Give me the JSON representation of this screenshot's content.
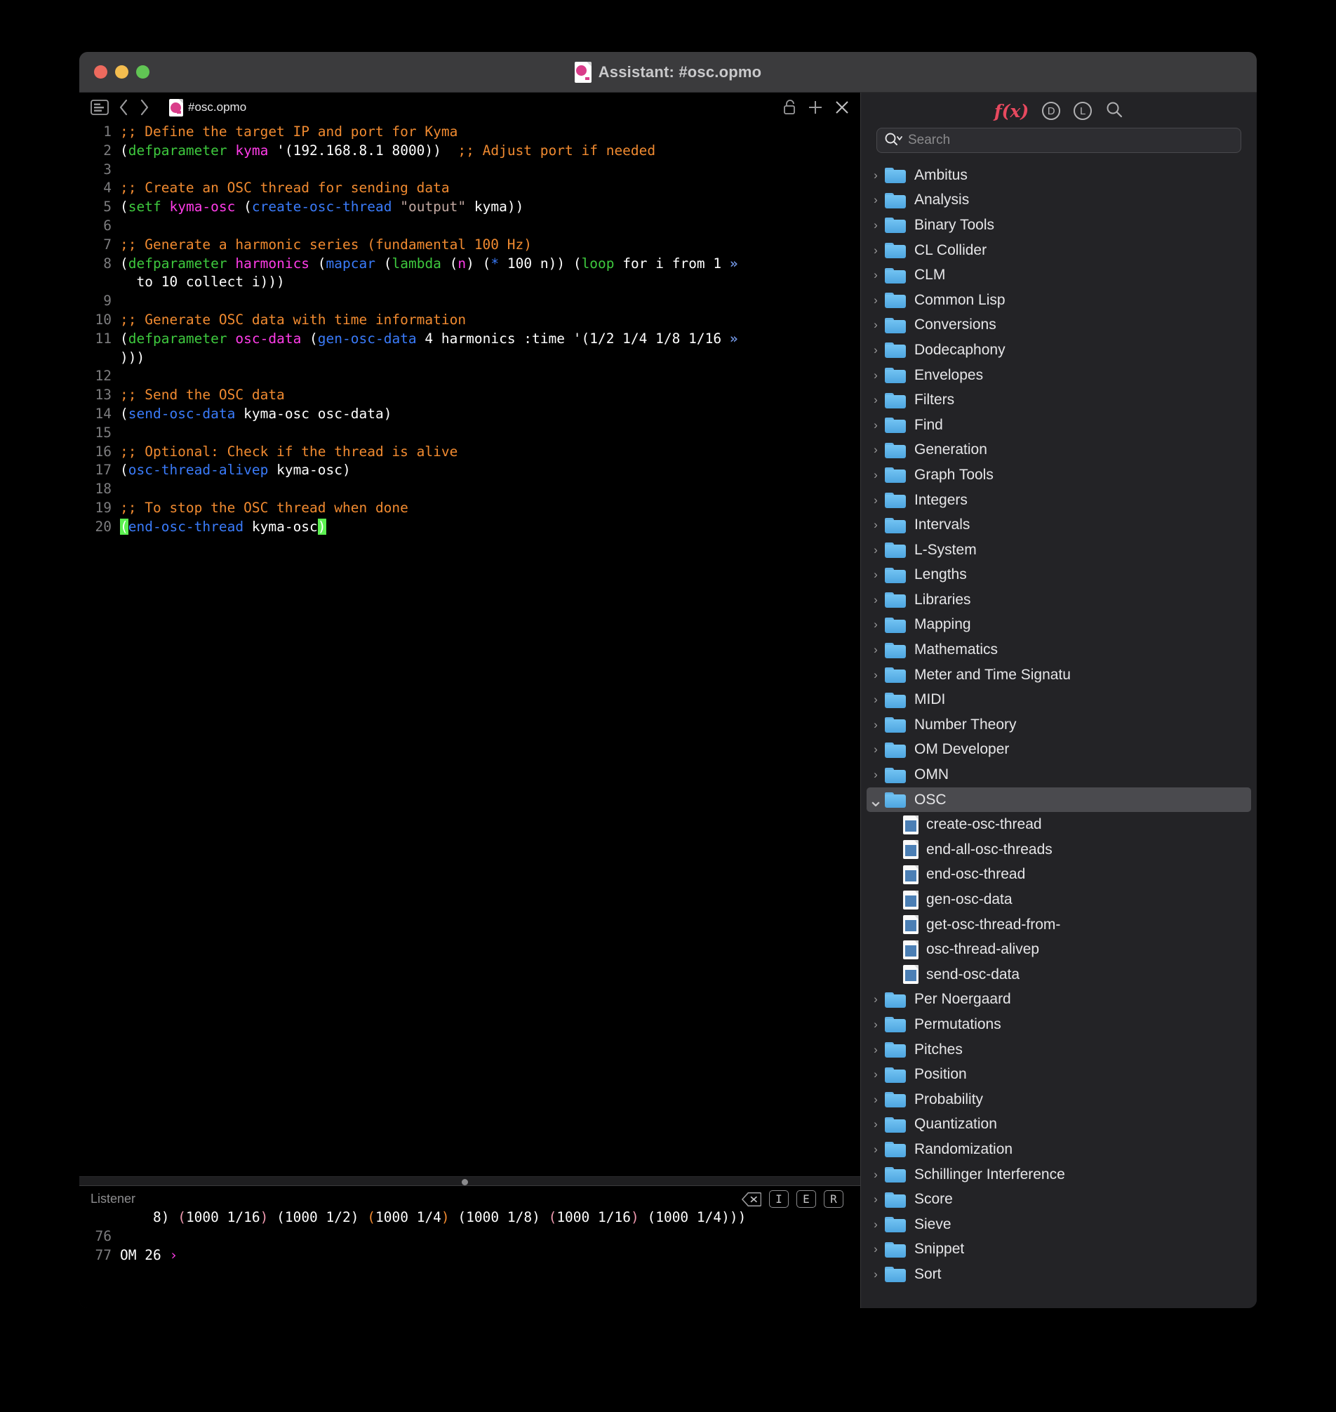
{
  "window": {
    "title": "Assistant: #osc.opmo",
    "traffic_lights": [
      "close",
      "minimize",
      "zoom"
    ]
  },
  "editor": {
    "tab_name": "#osc.opmo",
    "toolbar_icons": [
      "sidebar-icon",
      "back-icon",
      "forward-icon"
    ],
    "right_icons": [
      "unlock-icon",
      "add-icon",
      "close-icon"
    ],
    "lines": [
      {
        "n": "1",
        "tokens": [
          {
            "t": ";; Define the target IP and port for Kyma",
            "c": "c-comment"
          }
        ]
      },
      {
        "n": "2",
        "tokens": [
          {
            "t": "(",
            "c": "c-white"
          },
          {
            "t": "defparameter",
            "c": "c-green"
          },
          {
            "t": " ",
            "c": "c-white"
          },
          {
            "t": "kyma",
            "c": "c-magenta"
          },
          {
            "t": " '(192.168.8.1 8000))",
            "c": "c-white"
          },
          {
            "t": "  ;; Adjust port if needed",
            "c": "c-comment"
          }
        ]
      },
      {
        "n": "3",
        "tokens": []
      },
      {
        "n": "4",
        "tokens": [
          {
            "t": ";; Create an OSC thread for sending data",
            "c": "c-comment"
          }
        ]
      },
      {
        "n": "5",
        "tokens": [
          {
            "t": "(",
            "c": "c-white"
          },
          {
            "t": "setf",
            "c": "c-green"
          },
          {
            "t": " ",
            "c": "c-white"
          },
          {
            "t": "kyma-osc",
            "c": "c-magenta"
          },
          {
            "t": " (",
            "c": "c-white"
          },
          {
            "t": "create-osc-thread",
            "c": "c-blue"
          },
          {
            "t": " ",
            "c": "c-white"
          },
          {
            "t": "\"output\"",
            "c": "c-str"
          },
          {
            "t": " kyma))",
            "c": "c-white"
          }
        ]
      },
      {
        "n": "6",
        "tokens": []
      },
      {
        "n": "7",
        "tokens": [
          {
            "t": ";; Generate a harmonic series (fundamental 100 Hz)",
            "c": "c-comment"
          }
        ]
      },
      {
        "n": "8",
        "tokens": [
          {
            "t": "(",
            "c": "c-white"
          },
          {
            "t": "defparameter",
            "c": "c-green"
          },
          {
            "t": " ",
            "c": "c-white"
          },
          {
            "t": "harmonics",
            "c": "c-magenta"
          },
          {
            "t": " (",
            "c": "c-white"
          },
          {
            "t": "mapcar",
            "c": "c-blue"
          },
          {
            "t": " (",
            "c": "c-white"
          },
          {
            "t": "lambda",
            "c": "c-green"
          },
          {
            "t": " (",
            "c": "c-white"
          },
          {
            "t": "n",
            "c": "c-magenta"
          },
          {
            "t": ") (",
            "c": "c-white"
          },
          {
            "t": "*",
            "c": "c-blue"
          },
          {
            "t": " 100 n)) (",
            "c": "c-white"
          },
          {
            "t": "loop",
            "c": "c-green"
          },
          {
            "t": " for i from 1 ",
            "c": "c-white"
          },
          {
            "t": "»",
            "c": "wrapmark"
          }
        ],
        "wrap": "  to 10 collect i)))"
      },
      {
        "n": "9",
        "tokens": []
      },
      {
        "n": "10",
        "tokens": [
          {
            "t": ";; Generate OSC data with time information",
            "c": "c-comment"
          }
        ]
      },
      {
        "n": "11",
        "tokens": [
          {
            "t": "(",
            "c": "c-white"
          },
          {
            "t": "defparameter",
            "c": "c-green"
          },
          {
            "t": " ",
            "c": "c-white"
          },
          {
            "t": "osc-data",
            "c": "c-magenta"
          },
          {
            "t": " (",
            "c": "c-white"
          },
          {
            "t": "gen-osc-data",
            "c": "c-blue"
          },
          {
            "t": " 4 harmonics :time '(1/2 1/4 1/8 1/16 ",
            "c": "c-white"
          },
          {
            "t": "»",
            "c": "wrapmark"
          }
        ],
        "wrap": ")))"
      },
      {
        "n": "12",
        "tokens": []
      },
      {
        "n": "13",
        "tokens": [
          {
            "t": ";; Send the OSC data",
            "c": "c-comment"
          }
        ]
      },
      {
        "n": "14",
        "tokens": [
          {
            "t": "(",
            "c": "c-white"
          },
          {
            "t": "send-osc-data",
            "c": "c-blue"
          },
          {
            "t": " kyma-osc osc-data)",
            "c": "c-white"
          }
        ]
      },
      {
        "n": "15",
        "tokens": []
      },
      {
        "n": "16",
        "tokens": [
          {
            "t": ";; Optional: Check if the thread is alive",
            "c": "c-comment"
          }
        ]
      },
      {
        "n": "17",
        "tokens": [
          {
            "t": "(",
            "c": "c-white"
          },
          {
            "t": "osc-thread-alivep",
            "c": "c-blue"
          },
          {
            "t": " kyma-osc)",
            "c": "c-white"
          }
        ]
      },
      {
        "n": "18",
        "tokens": []
      },
      {
        "n": "19",
        "tokens": [
          {
            "t": ";; To stop the OSC thread when done",
            "c": "c-comment"
          }
        ]
      },
      {
        "n": "20",
        "tokens": [
          {
            "t": "(",
            "c": "sel"
          },
          {
            "t": "end-osc-thread",
            "c": "c-blue"
          },
          {
            "t": " kyma-osc",
            "c": "c-white"
          },
          {
            "t": ")",
            "c": "sel"
          }
        ]
      }
    ]
  },
  "listener": {
    "label": "Listener",
    "buttons": [
      "clear-icon",
      "I",
      "E",
      "R"
    ],
    "lines": [
      {
        "n": "",
        "tokens": [
          {
            "t": "    8) ",
            "c": "c-white"
          },
          {
            "t": "(",
            "c": "c-pink"
          },
          {
            "t": "1000 1/16",
            "c": "c-white"
          },
          {
            "t": ")",
            "c": "c-pink"
          },
          {
            "t": " (1000 1/2) ",
            "c": "c-white"
          },
          {
            "t": "(",
            "c": "c-comment"
          },
          {
            "t": "1000 1/4",
            "c": "c-white"
          },
          {
            "t": ")",
            "c": "c-comment"
          },
          {
            "t": " (1000 1/8) ",
            "c": "c-white"
          },
          {
            "t": "(",
            "c": "c-pink"
          },
          {
            "t": "1000 1/16",
            "c": "c-white"
          },
          {
            "t": ")",
            "c": "c-pink"
          },
          {
            "t": " (1000 1/4)))",
            "c": "c-white"
          }
        ]
      },
      {
        "n": "76",
        "tokens": []
      },
      {
        "n": "77",
        "tokens": [
          {
            "t": "OM 26 ",
            "c": "c-white"
          },
          {
            "t": "›",
            "c": "c-magenta"
          }
        ]
      }
    ]
  },
  "right_panel": {
    "header_icons": [
      "fx-icon",
      "documentation-icon",
      "library-icon",
      "search-icon"
    ],
    "fx_label": "f(x)",
    "d_label": "D",
    "l_label": "L",
    "search_placeholder": "Search",
    "search_value": "",
    "tree": [
      {
        "label": "Ambitus",
        "type": "folder",
        "state": "collapsed"
      },
      {
        "label": "Analysis",
        "type": "folder",
        "state": "collapsed"
      },
      {
        "label": "Binary Tools",
        "type": "folder",
        "state": "collapsed"
      },
      {
        "label": "CL Collider",
        "type": "folder",
        "state": "collapsed"
      },
      {
        "label": "CLM",
        "type": "folder",
        "state": "collapsed"
      },
      {
        "label": "Common Lisp",
        "type": "folder",
        "state": "collapsed"
      },
      {
        "label": "Conversions",
        "type": "folder",
        "state": "collapsed"
      },
      {
        "label": "Dodecaphony",
        "type": "folder",
        "state": "collapsed"
      },
      {
        "label": "Envelopes",
        "type": "folder",
        "state": "collapsed"
      },
      {
        "label": "Filters",
        "type": "folder",
        "state": "collapsed"
      },
      {
        "label": "Find",
        "type": "folder",
        "state": "collapsed"
      },
      {
        "label": "Generation",
        "type": "folder",
        "state": "collapsed"
      },
      {
        "label": "Graph Tools",
        "type": "folder",
        "state": "collapsed"
      },
      {
        "label": "Integers",
        "type": "folder",
        "state": "collapsed"
      },
      {
        "label": "Intervals",
        "type": "folder",
        "state": "collapsed"
      },
      {
        "label": "L-System",
        "type": "folder",
        "state": "collapsed"
      },
      {
        "label": "Lengths",
        "type": "folder",
        "state": "collapsed"
      },
      {
        "label": "Libraries",
        "type": "folder",
        "state": "collapsed"
      },
      {
        "label": "Mapping",
        "type": "folder",
        "state": "collapsed"
      },
      {
        "label": "Mathematics",
        "type": "folder",
        "state": "collapsed"
      },
      {
        "label": "Meter and Time Signatu",
        "type": "folder",
        "state": "collapsed"
      },
      {
        "label": "MIDI",
        "type": "folder",
        "state": "collapsed"
      },
      {
        "label": "Number Theory",
        "type": "folder",
        "state": "collapsed"
      },
      {
        "label": "OM Developer",
        "type": "folder",
        "state": "collapsed"
      },
      {
        "label": "OMN",
        "type": "folder",
        "state": "collapsed"
      },
      {
        "label": "OSC",
        "type": "folder",
        "state": "expanded",
        "selected": true
      },
      {
        "label": "create-osc-thread",
        "type": "file"
      },
      {
        "label": "end-all-osc-threads",
        "type": "file"
      },
      {
        "label": "end-osc-thread",
        "type": "file"
      },
      {
        "label": "gen-osc-data",
        "type": "file"
      },
      {
        "label": "get-osc-thread-from-",
        "type": "file"
      },
      {
        "label": "osc-thread-alivep",
        "type": "file"
      },
      {
        "label": "send-osc-data",
        "type": "file"
      },
      {
        "label": "Per Noergaard",
        "type": "folder",
        "state": "collapsed"
      },
      {
        "label": "Permutations",
        "type": "folder",
        "state": "collapsed"
      },
      {
        "label": "Pitches",
        "type": "folder",
        "state": "collapsed"
      },
      {
        "label": "Position",
        "type": "folder",
        "state": "collapsed"
      },
      {
        "label": "Probability",
        "type": "folder",
        "state": "collapsed"
      },
      {
        "label": "Quantization",
        "type": "folder",
        "state": "collapsed"
      },
      {
        "label": "Randomization",
        "type": "folder",
        "state": "collapsed"
      },
      {
        "label": "Schillinger Interference",
        "type": "folder",
        "state": "collapsed"
      },
      {
        "label": "Score",
        "type": "folder",
        "state": "collapsed"
      },
      {
        "label": "Sieve",
        "type": "folder",
        "state": "collapsed"
      },
      {
        "label": "Snippet",
        "type": "folder",
        "state": "collapsed"
      },
      {
        "label": "Sort",
        "type": "folder",
        "state": "collapsed"
      }
    ]
  },
  "colors": {
    "comment": "#f08a30",
    "keyword": "#3ec93e",
    "variable": "#ff3ce8",
    "function": "#3a7bfa",
    "string": "#c0a7a0",
    "selection": "#5cf051",
    "accent_red": "#e8495f",
    "folder_blue": "#62b3e8"
  }
}
